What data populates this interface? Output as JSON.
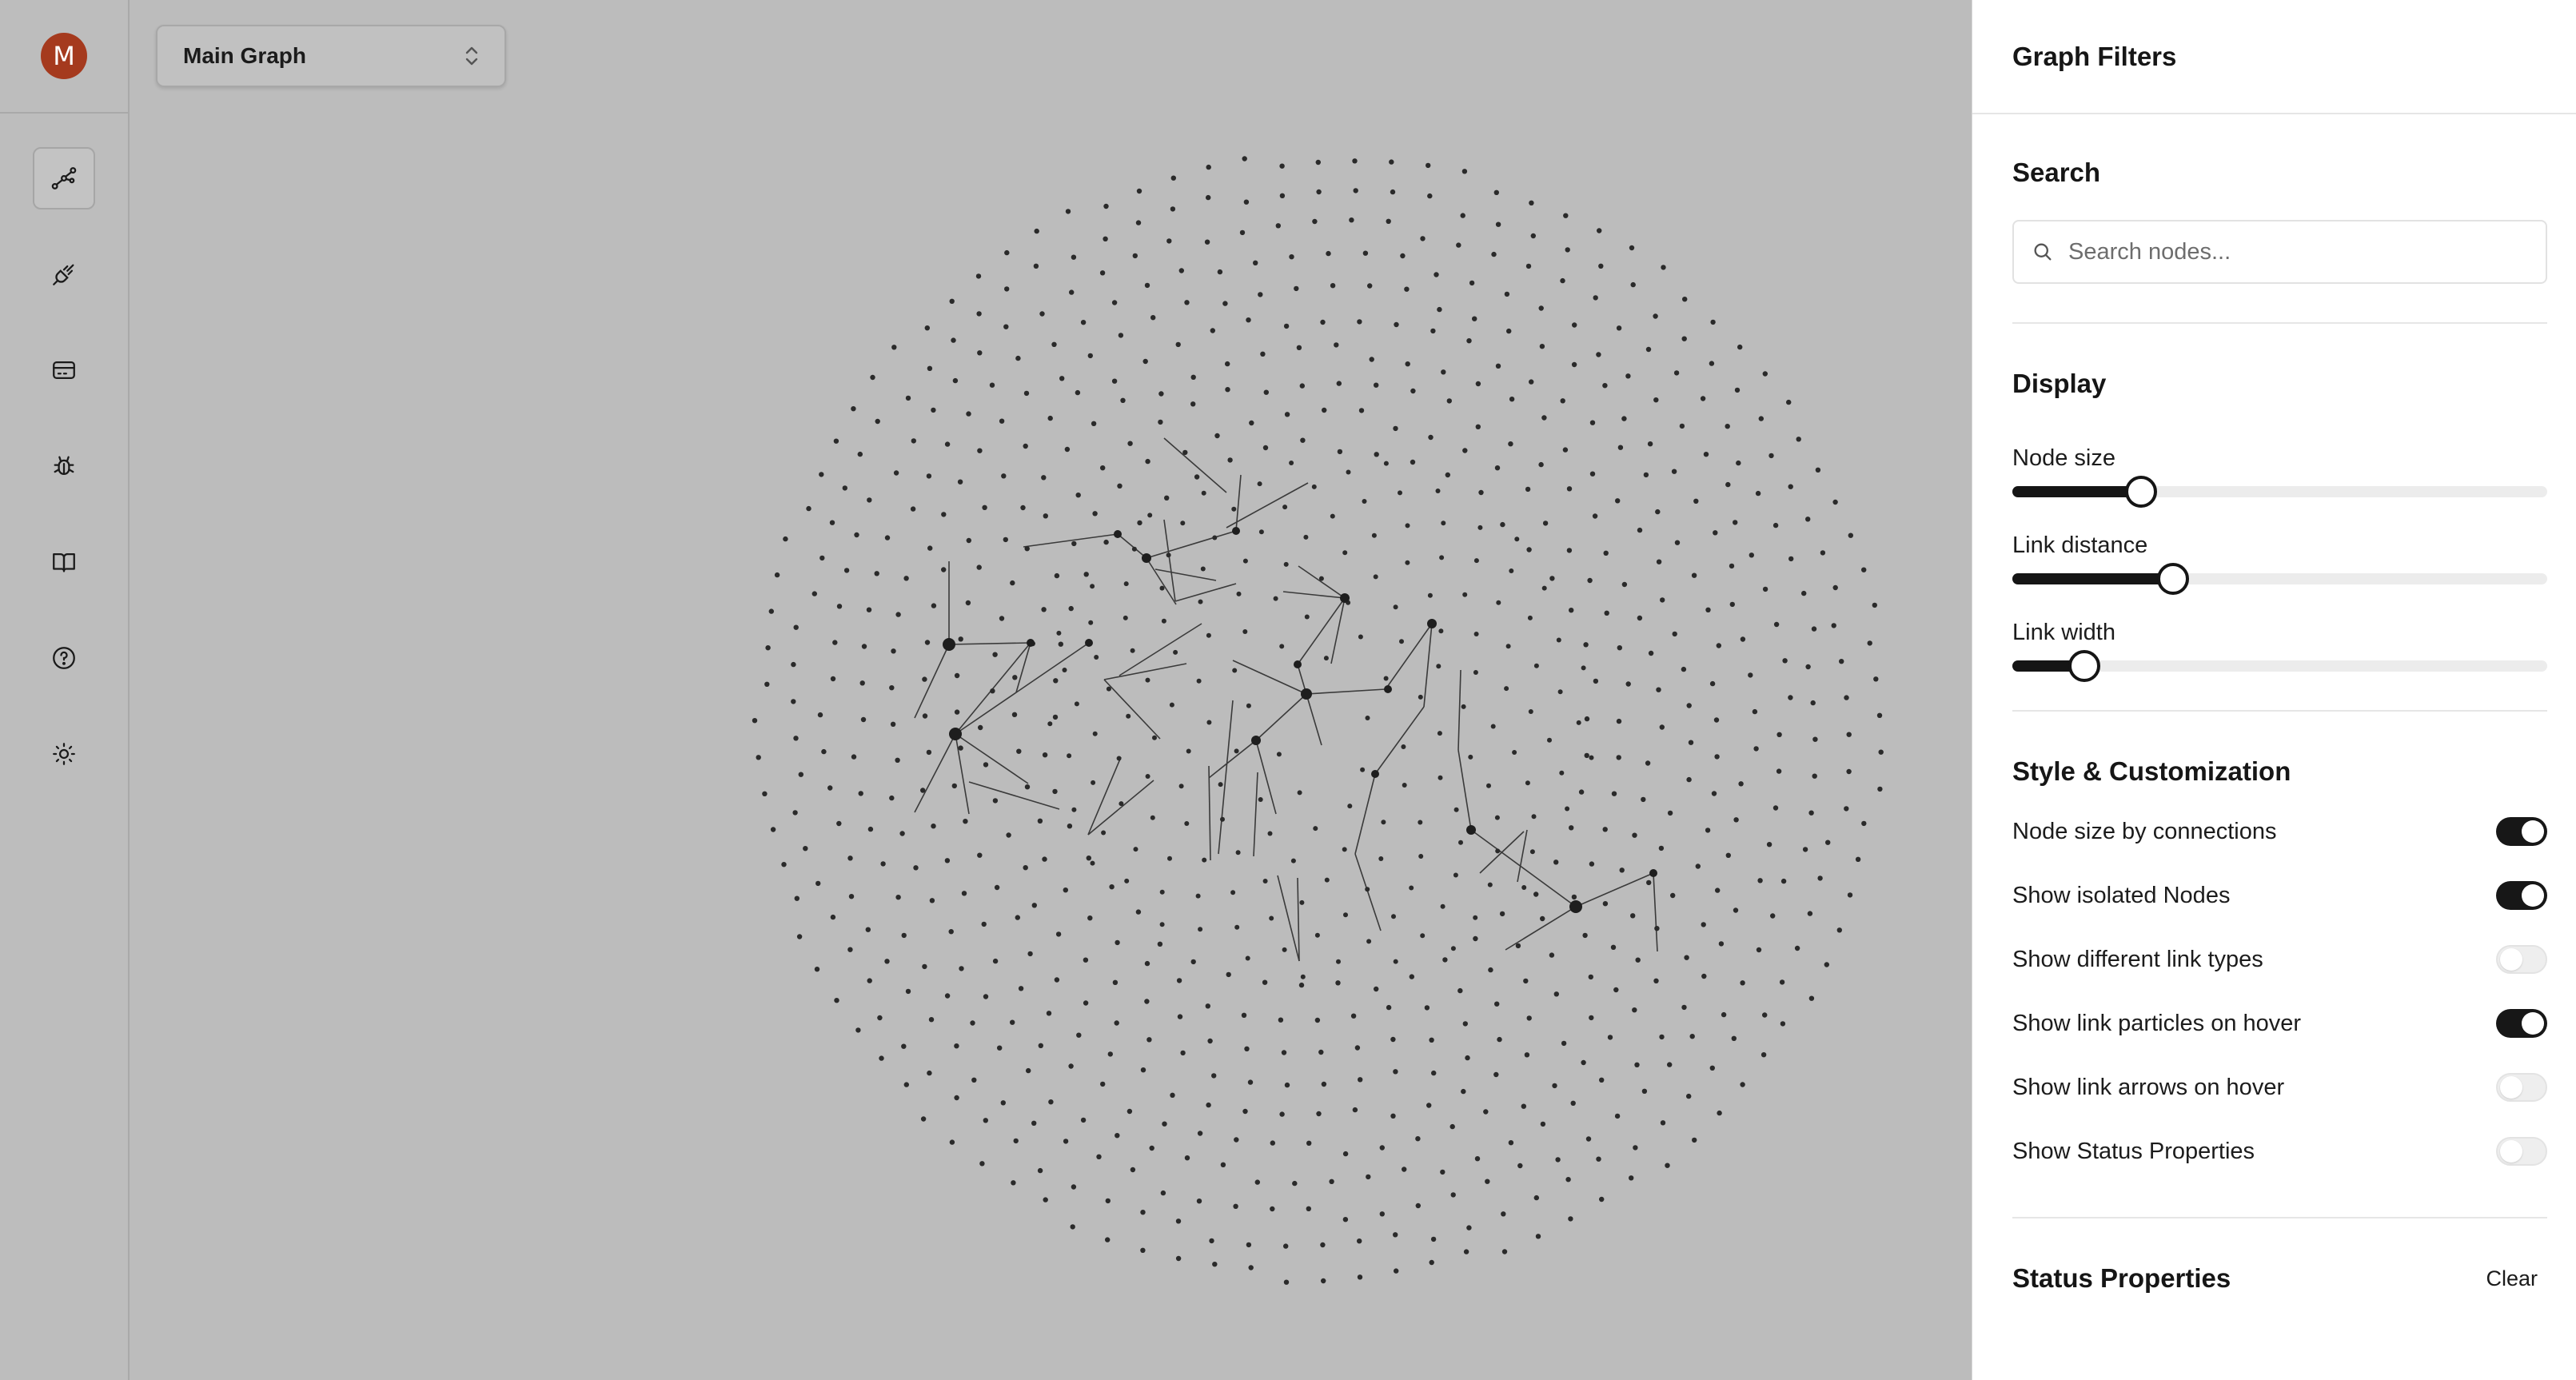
{
  "user": {
    "avatar_initial": "M",
    "avatar_color": "#a53a1e"
  },
  "rail": {
    "items": [
      {
        "icon": "graph-icon",
        "active": true
      },
      {
        "icon": "plug-icon",
        "active": false
      },
      {
        "icon": "card-icon",
        "active": false
      },
      {
        "icon": "bug-icon",
        "active": false
      },
      {
        "icon": "book-icon",
        "active": false
      },
      {
        "icon": "help-icon",
        "active": false
      },
      {
        "icon": "sun-icon",
        "active": false
      }
    ]
  },
  "graph_selector": {
    "label": "Main Graph",
    "icon": "chevron-up-down-icon"
  },
  "panel": {
    "title": "Graph Filters",
    "search": {
      "title": "Search",
      "placeholder": "Search nodes...",
      "value": ""
    },
    "display": {
      "title": "Display",
      "sliders": [
        {
          "label": "Node size",
          "value": 0.24
        },
        {
          "label": "Link distance",
          "value": 0.3
        },
        {
          "label": "Link width",
          "value": 0.135
        }
      ]
    },
    "style": {
      "title": "Style & Customization",
      "toggles": [
        {
          "label": "Node size by connections",
          "on": true
        },
        {
          "label": "Show isolated Nodes",
          "on": true
        },
        {
          "label": "Show different link types",
          "on": false
        },
        {
          "label": "Show link particles on hover",
          "on": true
        },
        {
          "label": "Show link arrows on hover",
          "on": false
        },
        {
          "label": "Show Status Properties",
          "on": false
        }
      ]
    },
    "status_properties": {
      "title": "Status Properties",
      "clear_label": "Clear"
    }
  },
  "colors": {
    "accent": "#151515",
    "canvas_bg": "#bcbcbc",
    "node": "#2a2a2a"
  }
}
